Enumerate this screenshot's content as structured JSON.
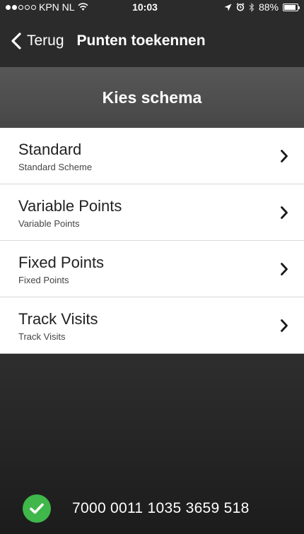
{
  "status_bar": {
    "carrier": "KPN NL",
    "time": "10:03",
    "battery_percent": "88%",
    "battery_level": 0.88,
    "icons": [
      "signal-dots-icon",
      "wifi-icon",
      "location-arrow-icon",
      "alarm-icon",
      "bluetooth-icon",
      "battery-icon"
    ]
  },
  "nav": {
    "back_label": "Terug",
    "title": "Punten toekennen"
  },
  "section": {
    "title": "Kies schema"
  },
  "schemes": [
    {
      "title": "Standard",
      "subtitle": "Standard Scheme"
    },
    {
      "title": "Variable Points",
      "subtitle": "Variable Points"
    },
    {
      "title": "Fixed Points",
      "subtitle": "Fixed Points"
    },
    {
      "title": "Track Visits",
      "subtitle": "Track Visits"
    }
  ],
  "card": {
    "number": "7000 0011 1035 3659 518",
    "status_icon": "check-circle-icon",
    "status_color": "#3fb74a"
  }
}
